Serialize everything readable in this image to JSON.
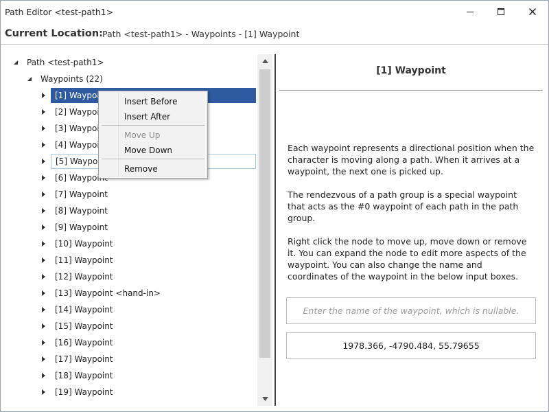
{
  "window": {
    "title": "Path Editor <test-path1>"
  },
  "location": {
    "label": "Current Location:",
    "path": "Path <test-path1> - Waypoints - [1] Waypoint"
  },
  "tree": {
    "root": "Path <test-path1>",
    "group": "Waypoints (22)",
    "items": [
      "[1] Waypoint",
      "[2] Waypoint",
      "[3] Waypoint",
      "[4] Waypoint",
      "[5] Waypoint",
      "[6] Waypoint",
      "[7] Waypoint",
      "[8] Waypoint",
      "[9] Waypoint",
      "[10] Waypoint",
      "[11] Waypoint",
      "[12] Waypoint",
      "[13] Waypoint <hand-in>",
      "[14] Waypoint",
      "[15] Waypoint",
      "[16] Waypoint",
      "[17] Waypoint",
      "[18] Waypoint",
      "[19] Waypoint"
    ],
    "selected_index": 0,
    "hovered_index": 4
  },
  "context_menu": {
    "insert_before": "Insert Before",
    "insert_after": "Insert After",
    "move_up": "Move Up",
    "move_down": "Move Down",
    "remove": "Remove"
  },
  "detail": {
    "heading": "[1] Waypoint",
    "paragraphs": [
      "Each waypoint represents a directional position when the character is moving along a path. When it arrives at a waypoint, the next one is picked up.",
      "The rendezvous of a path group is a special waypoint that acts as the #0 waypoint of each path in the path group.",
      "Right click the node to move up, move down or remove it. You can expand the node to edit more aspects of the waypoint. You can also change the name and coordinates of the waypoint in the below input boxes."
    ],
    "name_placeholder": "Enter the name of the waypoint, which is nullable.",
    "name_value": "",
    "coordinates_value": "1978.366, -4790.484, 55.79655"
  },
  "colors": {
    "selection": "#2d5aa0",
    "hover_border": "#a8c8da"
  }
}
